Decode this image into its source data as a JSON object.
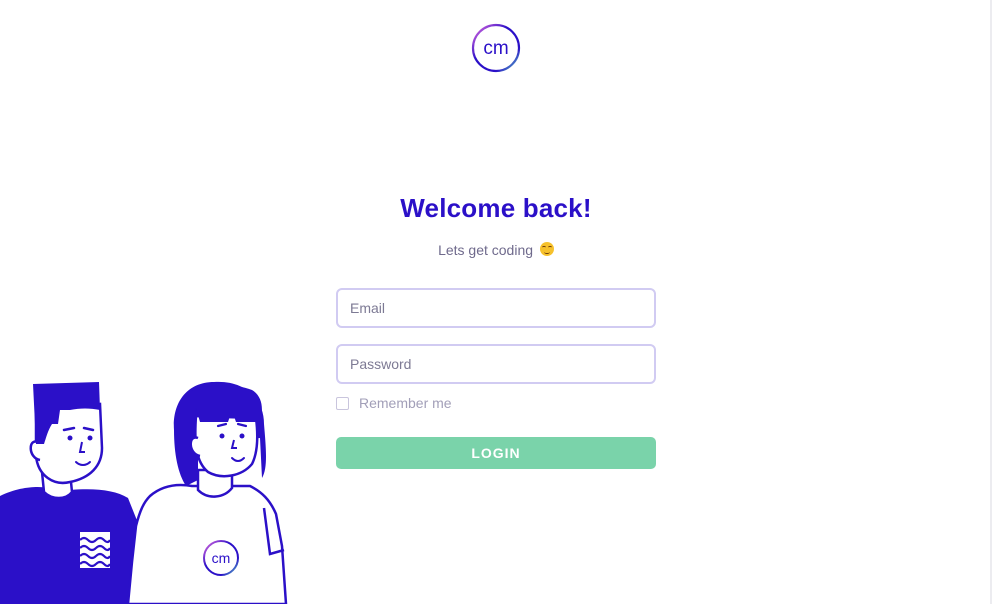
{
  "app": {
    "logo_icon": "cm-logo-icon",
    "logo_text": "cm"
  },
  "colors": {
    "primary": "#2b10c8",
    "login_button": "#7ad3aa",
    "field_border": "#d1cbf2",
    "subtitle": "#6f6a8c"
  },
  "login_form": {
    "title": "Welcome back!",
    "subtitle": "Lets get coding",
    "subtitle_emoji": "smiling-face-emoji",
    "email_placeholder": "Email",
    "email_value": "",
    "password_placeholder": "Password",
    "password_value": "",
    "remember_label": "Remember me",
    "remember_checked": false,
    "login_label": "LOGIN"
  },
  "illustration": {
    "shirt_logo_text": "cm"
  }
}
